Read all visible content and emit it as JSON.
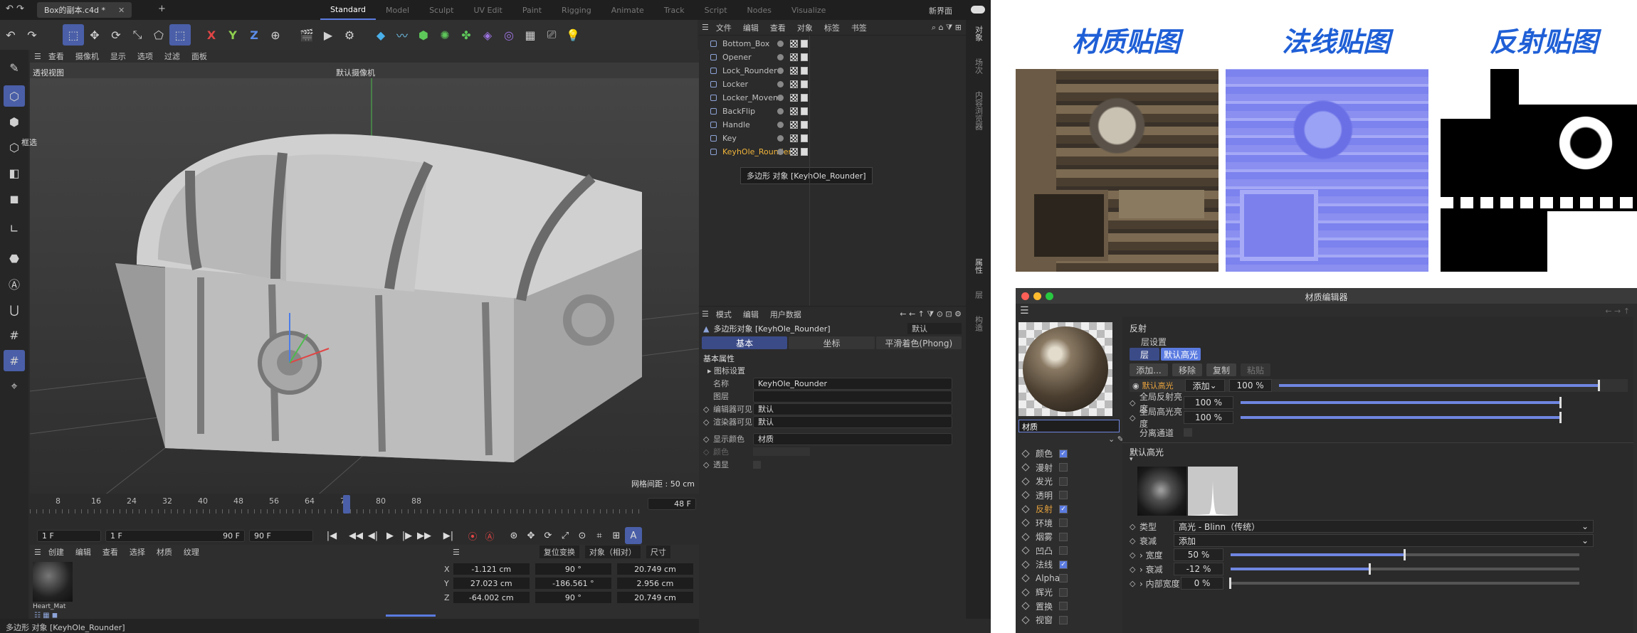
{
  "app": {
    "tab_title": "Box的副本.c4d *",
    "layouts": [
      "Standard",
      "Model",
      "Sculpt",
      "UV Edit",
      "Paint",
      "Rigging",
      "Animate",
      "Track",
      "Script",
      "Nodes",
      "Visualize"
    ],
    "new_interface": "新界面"
  },
  "viewport": {
    "menu": [
      "查看",
      "摄像机",
      "显示",
      "选项",
      "过滤",
      "面板"
    ],
    "view_name": "透视视图",
    "camera": "默认摄像机",
    "grid_spacing": "网格间距 : 50 cm",
    "box_select": "框选"
  },
  "object_manager": {
    "menu": [
      "文件",
      "编辑",
      "查看",
      "对象",
      "标签",
      "书签"
    ],
    "objects": [
      "Bottom_Box",
      "Opener",
      "Lock_Rounder",
      "Locker",
      "Locker_Movent",
      "BackFlip",
      "Handle",
      "Key",
      "KeyhOle_Rounder"
    ],
    "selected_index": 8,
    "tooltip": "多边形 对象 [KeyhOle_Rounder]"
  },
  "side_tabs": {
    "right1": "对象",
    "right2": "场次",
    "right3": "内容浏览器",
    "attr_tab": "属性",
    "layer_tab": "层",
    "struct_tab": "构造"
  },
  "attributes": {
    "menu": [
      "模式",
      "编辑",
      "用户数据"
    ],
    "title": "多边形对象 [KeyhOle_Rounder]",
    "preset": "默认",
    "tabs": [
      "基本",
      "坐标",
      "平滑着色(Phong)"
    ],
    "section": "基本属性",
    "subsection": "图标设置",
    "name_label": "名称",
    "name_value": "KeyhOle_Rounder",
    "layer_label": "图层",
    "editor_vis_label": "编辑器可见",
    "editor_vis_value": "默认",
    "render_vis_label": "渲染器可见",
    "render_vis_value": "默认",
    "display_color_label": "显示颜色",
    "display_color_value": "材质",
    "color_label": "颜色",
    "transparent_label": "透显"
  },
  "timeline": {
    "ticks": [
      "8",
      "16",
      "24",
      "32",
      "40",
      "48",
      "56",
      "64",
      "72",
      "80",
      "88"
    ],
    "current": "48 F",
    "start": "1 F",
    "start2": "1 F",
    "end": "90 F",
    "end2": "90 F"
  },
  "material_manager": {
    "menu": [
      "创建",
      "编辑",
      "查看",
      "选择",
      "材质",
      "纹理"
    ],
    "material_name": "Heart_Mat"
  },
  "coordinates": {
    "reset": "复位变换",
    "mode": "对象（相对）",
    "size": "尺寸",
    "rows": [
      {
        "axis": "X",
        "pos": "-1.121 cm",
        "rot": "90 °",
        "size": "20.749 cm"
      },
      {
        "axis": "Y",
        "pos": "27.023 cm",
        "rot": "-186.561 °",
        "size": "2.956 cm"
      },
      {
        "axis": "Z",
        "pos": "-64.002 cm",
        "rot": "90 °",
        "size": "20.749 cm"
      }
    ]
  },
  "status_bar": "多边形 对象 [KeyhOle_Rounder]",
  "textures": {
    "titles": [
      "材质贴图",
      "法线贴图",
      "反射贴图"
    ]
  },
  "material_editor": {
    "title": "材质编辑器",
    "name_field": "材质",
    "channels": [
      {
        "label": "颜色",
        "on": true
      },
      {
        "label": "漫射",
        "on": false
      },
      {
        "label": "发光",
        "on": false
      },
      {
        "label": "透明",
        "on": false
      },
      {
        "label": "反射",
        "on": true,
        "active": true
      },
      {
        "label": "环境",
        "on": false
      },
      {
        "label": "烟雾",
        "on": false
      },
      {
        "label": "凹凸",
        "on": false
      },
      {
        "label": "法线",
        "on": true
      },
      {
        "label": "Alpha",
        "on": false
      },
      {
        "label": "辉光",
        "on": false
      },
      {
        "label": "置换",
        "on": false
      },
      {
        "label": "视窗",
        "on": false
      }
    ],
    "section": "反射",
    "layer_settings": "层设置",
    "tab_layer": "层",
    "tab_default": "默认高光",
    "btn_add": "添加...",
    "btn_remove": "移除",
    "btn_copy": "复制",
    "btn_paste": "粘贴",
    "default_spec": "默认高光",
    "blend_mode": "添加",
    "layer_pct": "100 %",
    "layer_pct_value": 1.0,
    "global_refl_label": "全局反射亮度",
    "global_refl": "100 %",
    "global_refl_value": 1.0,
    "global_spec_label": "全局高光亮度",
    "global_spec": "100 %",
    "global_spec_value": 1.0,
    "separate_label": "分离通道",
    "spec_section": "默认高光",
    "type_label": "类型",
    "type_value": "高光 - Blinn（传统）",
    "atten_label": "衰减",
    "atten_value": "添加",
    "width_label": "宽度",
    "width": "50 %",
    "width_value": 0.5,
    "falloff_label": "衰减",
    "falloff": "-12 %",
    "falloff_value": 0.4,
    "inner_label": "内部宽度",
    "inner": "0 %",
    "inner_value": 0.0,
    "accent": "#5b7be0"
  }
}
